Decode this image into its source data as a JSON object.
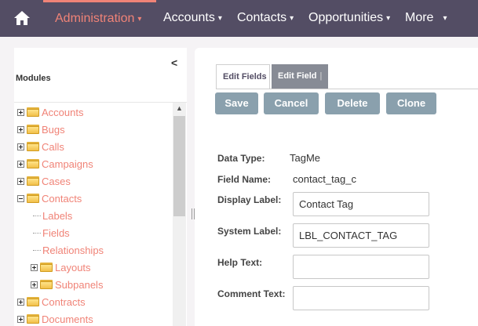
{
  "nav": {
    "home_icon": "home-icon",
    "items": [
      {
        "label": "Administration"
      },
      {
        "label": "Accounts"
      },
      {
        "label": "Contacts"
      },
      {
        "label": "Opportunities"
      },
      {
        "label": "More"
      }
    ],
    "caret": "▾",
    "active_color": "#f08377",
    "bar_color": "#534d64"
  },
  "sidebar": {
    "collapse_glyph": "<",
    "title": "Modules",
    "tree": [
      {
        "label": "Accounts"
      },
      {
        "label": "Bugs"
      },
      {
        "label": "Calls"
      },
      {
        "label": "Campaigns"
      },
      {
        "label": "Cases"
      },
      {
        "label": "Contacts"
      },
      {
        "label": "Labels"
      },
      {
        "label": "Fields"
      },
      {
        "label": "Relationships"
      },
      {
        "label": "Layouts"
      },
      {
        "label": "Subpanels"
      },
      {
        "label": "Contracts"
      },
      {
        "label": "Documents"
      }
    ],
    "link_color": "#f08377"
  },
  "tabs": {
    "edit_fields": "Edit Fields",
    "edit_field": "Edit Field",
    "divider": "|"
  },
  "buttons": {
    "save": "Save",
    "cancel": "Cancel",
    "delete": "Delete",
    "clone": "Clone"
  },
  "form": {
    "data_type_label": "Data Type:",
    "data_type_value": "TagMe",
    "field_name_label": "Field Name:",
    "field_name_value": "contact_tag_c",
    "display_label_label": "Display Label:",
    "display_label_value": "Contact Tag",
    "system_label_label": "System Label:",
    "system_label_value": "LBL_CONTACT_TAG",
    "help_text_label": "Help Text:",
    "help_text_value": "",
    "comment_text_label": "Comment Text:",
    "comment_text_value": ""
  }
}
